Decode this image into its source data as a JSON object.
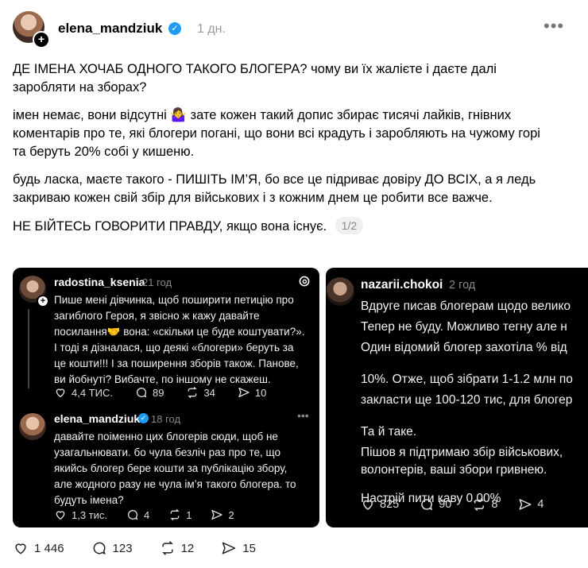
{
  "post": {
    "username": "elena_mandziuk",
    "time": "1 дн.",
    "more": "•••",
    "paragraphs": [
      "ДЕ ІМЕНА ХОЧАБ ОДНОГО ТАКОГО БЛОГЕРА? чому ви їх жалієте і даєте далі заробляти на зборах?",
      "імен немає, вони відсутні 🤷‍♀️ зате кожен такий допис збирає тисячі лайків, гнівних коментарів про те, які блогери погані, що вони всі крадуть і заробляють на чужому горі та беруть 20% собі у кишеню.",
      "будь ласка, маєте такого - ПИШІТЬ ІМ’Я, бо все це підриває довіру ДО ВСІХ, а я ледь закриваю кожен свій збір для військових і з кожним днем це робити все важче."
    ],
    "last_line": "НЕ БІЙТЕСЬ ГОВОРИТИ ПРАВДУ, якщо вона існує.",
    "page_indicator": "1/2",
    "stats": {
      "likes": "1 446",
      "comments": "123",
      "reposts": "12",
      "shares": "15"
    }
  },
  "card1": {
    "post1": {
      "username": "radostina_ksenia",
      "time": "21 год",
      "lines": [
        "Пише мені дівчинка, щоб поширити петицію про",
        "загиблого Героя, я звісно ж кажу давайте",
        "посилання🤝 вона: «скільки це буде коштувати?».",
        "І тоді я дізналася, що деякі «блогери» беруть за",
        "це кошти!!! І за поширення зборів також. Панове,",
        "ви йобнуті? Вибачте, по іншому не скажеш."
      ],
      "stats": {
        "likes": "4,4 ТИС.",
        "comments": "89",
        "reposts": "34",
        "shares": "10"
      }
    },
    "post2": {
      "username": "elena_mandziuk",
      "time": "18 год",
      "lines": [
        "давайте поіменно цих блогерів сюди, щоб не",
        "узагальнювати. бо чула безліч раз про те, що",
        "якийсь блогер бере кошти за публікацію збору,",
        "але жодного разу не чула ім’я такого блогера. то",
        "будуть імена?"
      ],
      "stats": {
        "likes": "1,3 тис.",
        "comments": "4",
        "reposts": "1",
        "shares": "2"
      }
    }
  },
  "card2": {
    "username": "nazarii.chokoi",
    "time": "2 год",
    "lines": [
      "Вдруге писав блогерам щодо велико",
      "Тепер не буду. Можливо тегну але н",
      "Один відомий блогер захотіла % від"
    ],
    "lines2": [
      "10%. Отже, щоб зібрати 1-1.2 млн по",
      "закласти ще 100-120 тис, для блогер"
    ],
    "lines3": [
      "Та й таке.",
      "Пішов я підтримаю збір військових,",
      "волонтерів, ваші збори гривнею."
    ],
    "lines4": [
      "Настрій пити каву 0.00%"
    ],
    "stats": {
      "likes": "825",
      "comments": "90",
      "reposts": "8",
      "shares": "4"
    }
  }
}
